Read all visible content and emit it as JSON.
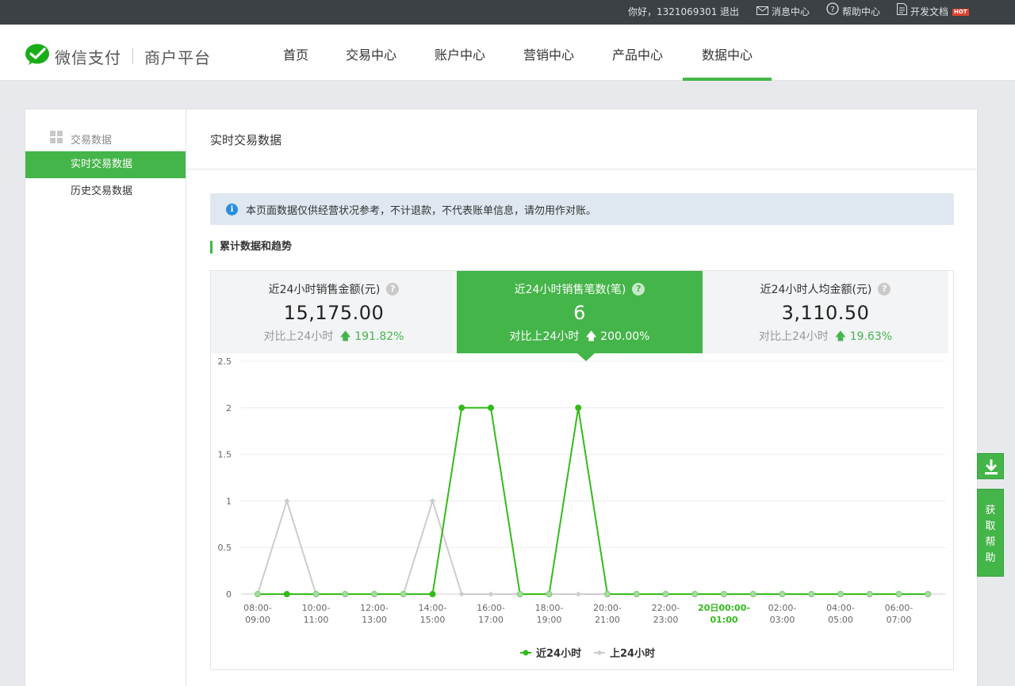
{
  "topbar": {
    "greeting": "你好，1321069301",
    "logout": "退出",
    "messages": "消息中心",
    "help": "帮助中心",
    "docs": "开发文档",
    "hot_badge": "HOT"
  },
  "header": {
    "brand": "微信支付",
    "platform": "商户平台",
    "nav": [
      "首页",
      "交易中心",
      "账户中心",
      "营销中心",
      "产品中心",
      "数据中心"
    ],
    "active_nav": "数据中心"
  },
  "sidebar": {
    "group": "交易数据",
    "items": [
      "实时交易数据",
      "历史交易数据"
    ],
    "active": "实时交易数据"
  },
  "content": {
    "title": "实时交易数据",
    "notice": "本页面数据仅供经营状况参考，不计退款，不代表账单信息，请勿用作对账。",
    "section_title": "累计数据和趋势"
  },
  "stats": [
    {
      "label": "近24小时销售金额(元)",
      "value": "15,175.00",
      "compare_label": "对比上24小时",
      "change": "191.82%"
    },
    {
      "label": "近24小时销售笔数(笔)",
      "value": "6",
      "compare_label": "对比上24小时",
      "change": "200.00%"
    },
    {
      "label": "近24小时人均金额(元)",
      "value": "3,110.50",
      "compare_label": "对比上24小时",
      "change": "19.63%"
    }
  ],
  "active_stat": 1,
  "float": {
    "help": "获取帮助"
  },
  "colors": {
    "accent": "#44b549",
    "topbar": "#3c4145",
    "gray_series": "#cccccc"
  },
  "chart_data": {
    "type": "line",
    "ylim": [
      0,
      2.5
    ],
    "yticks": [
      "0",
      "0.5",
      "1",
      "1.5",
      "2",
      "2.5"
    ],
    "xtick_labels": [
      [
        "08:00-",
        "09:00"
      ],
      [
        "10:00-",
        "11:00"
      ],
      [
        "12:00-",
        "13:00"
      ],
      [
        "14:00-",
        "15:00"
      ],
      [
        "16:00-",
        "17:00"
      ],
      [
        "18:00-",
        "19:00"
      ],
      [
        "20:00-",
        "21:00"
      ],
      [
        "22:00-",
        "23:00"
      ],
      [
        "20日00:00-",
        "01:00"
      ],
      [
        "02:00-",
        "03:00"
      ],
      [
        "04:00-",
        "05:00"
      ],
      [
        "06:00-",
        "07:00"
      ]
    ],
    "highlight_tick": 8,
    "series": [
      {
        "name": "近24小时",
        "color": "#33bb1a",
        "values": [
          0,
          0,
          0,
          0,
          0,
          0,
          0,
          2,
          2,
          0,
          0,
          2,
          0,
          0,
          0,
          0,
          0,
          0,
          0,
          0,
          0,
          0,
          0,
          0
        ]
      },
      {
        "name": "上24小时",
        "color": "#cccccc",
        "values": [
          0,
          1,
          0,
          0,
          0,
          0,
          1,
          0,
          0,
          0,
          0,
          0,
          0,
          0,
          0,
          0,
          0,
          0,
          0,
          0,
          0,
          0,
          0,
          0
        ]
      }
    ]
  }
}
